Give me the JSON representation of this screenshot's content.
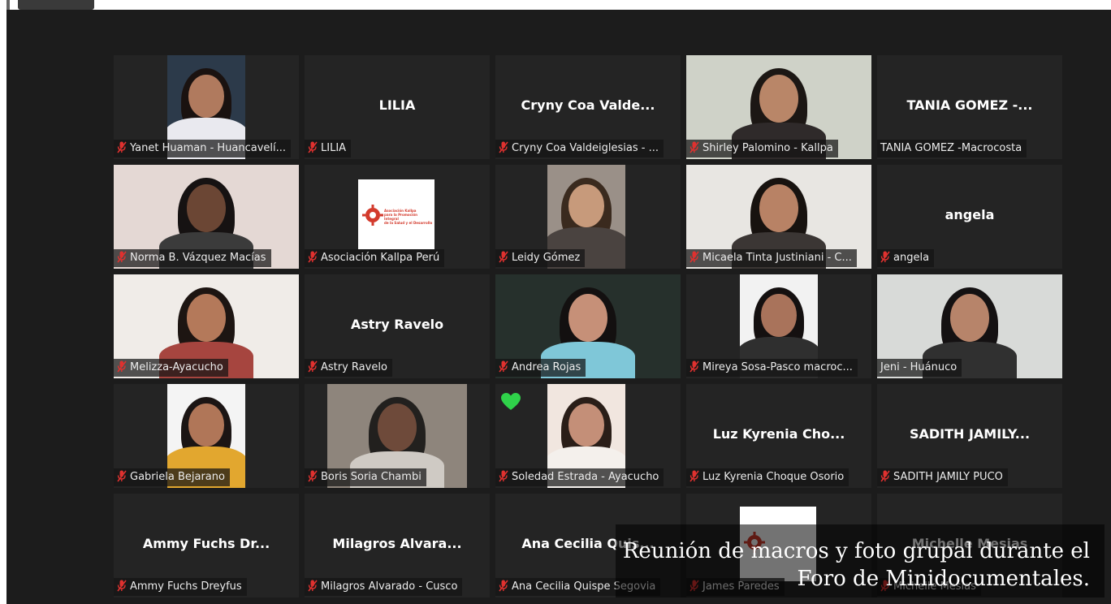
{
  "participants": [
    {
      "name": "Yanet Huaman - Huancavelí...",
      "muted": true,
      "video": true
    },
    {
      "name": "LILIA",
      "muted": true,
      "video": false,
      "display": "LILIA"
    },
    {
      "name": "Cryny Coa Valdeiglesias - ...",
      "muted": true,
      "video": false,
      "display": "Cryny Coa Valde..."
    },
    {
      "name": "Shirley Palomino - Kallpa",
      "muted": true,
      "video": true
    },
    {
      "name": "TANIA GOMEZ -Macrocosta",
      "muted": false,
      "video": false,
      "display": "TANIA GOMEZ -..."
    },
    {
      "name": "Norma B. Vázquez Macías",
      "muted": true,
      "video": true
    },
    {
      "name": "Asociación Kallpa Perú",
      "muted": true,
      "video": true,
      "logo": true
    },
    {
      "name": "Leidy Gómez",
      "muted": true,
      "video": true
    },
    {
      "name": "Micaela Tinta Justiniani - C...",
      "muted": true,
      "video": true
    },
    {
      "name": "angela",
      "muted": true,
      "video": false,
      "display": "angela"
    },
    {
      "name": "Melizza-Ayacucho",
      "muted": true,
      "video": true
    },
    {
      "name": "Astry Ravelo",
      "muted": true,
      "video": false,
      "display": "Astry Ravelo"
    },
    {
      "name": "Andrea Rojas",
      "muted": true,
      "video": true
    },
    {
      "name": "Mireya Sosa-Pasco macroc...",
      "muted": true,
      "video": true
    },
    {
      "name": "Jeni - Huánuco",
      "muted": false,
      "video": true,
      "active": true
    },
    {
      "name": "Gabriela Bejarano",
      "muted": true,
      "video": true
    },
    {
      "name": "Boris Soria Chambi",
      "muted": true,
      "video": true
    },
    {
      "name": "Soledad Estrada - Ayacucho",
      "muted": true,
      "video": true,
      "reaction": "heart"
    },
    {
      "name": "Luz Kyrenia Choque Osorio",
      "muted": true,
      "video": false,
      "display": "Luz Kyrenia Cho..."
    },
    {
      "name": "SADITH JAMILY PUCO",
      "muted": true,
      "video": false,
      "display": "SADITH JAMILY..."
    },
    {
      "name": "Ammy Fuchs Dreyfus",
      "muted": true,
      "video": false,
      "display": "Ammy Fuchs Dr..."
    },
    {
      "name": "Milagros Alvarado - Cusco",
      "muted": true,
      "video": false,
      "display": "Milagros  Alvara..."
    },
    {
      "name": "Ana Cecilia Quispe Segovia",
      "muted": true,
      "video": false,
      "display": "Ana Cecilia Quis..."
    },
    {
      "name": "James Paredes",
      "muted": true,
      "video": true,
      "logo": true
    },
    {
      "name": "Michelle Mesias",
      "muted": true,
      "video": false,
      "display": "Michelle Mesias"
    }
  ],
  "logo_text": {
    "line1": "Asociación Kallpa",
    "line2": "para la Promoción Integral",
    "line3": "de la Salud y el Desarrollo"
  },
  "caption": {
    "line1": "Reunión de macros y foto grupal durante el",
    "line2": "Foro  de Minidocumentales."
  },
  "colors": {
    "background": "#1c1c1c",
    "tile": "#242424",
    "active_border": "#c6e13e",
    "muted_icon": "#e0312f",
    "heart": "#2fd24a"
  }
}
